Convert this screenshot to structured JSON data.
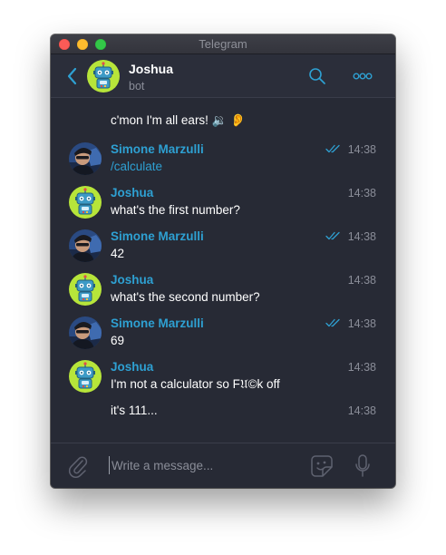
{
  "window": {
    "title": "Telegram"
  },
  "header": {
    "name": "Joshua",
    "status": "bot"
  },
  "messages": [
    {
      "kind": "continued",
      "sender": "",
      "text": "c'mon I'm all ears! 🔉 👂",
      "time": "",
      "outgoing": false,
      "avatar": ""
    },
    {
      "kind": "full",
      "sender": "Simone Marzulli",
      "text": "/calculate",
      "time": "14:38",
      "outgoing": true,
      "avatar": "user-photo",
      "link": true
    },
    {
      "kind": "full",
      "sender": "Joshua",
      "text": "what's the first number?",
      "time": "14:38",
      "outgoing": false,
      "avatar": "robot"
    },
    {
      "kind": "full",
      "sender": "Simone Marzulli",
      "text": "42",
      "time": "14:38",
      "outgoing": true,
      "avatar": "user-photo"
    },
    {
      "kind": "full",
      "sender": "Joshua",
      "text": "what's the second number?",
      "time": "14:38",
      "outgoing": false,
      "avatar": "robot"
    },
    {
      "kind": "full",
      "sender": "Simone Marzulli",
      "text": "69",
      "time": "14:38",
      "outgoing": true,
      "avatar": "user-photo"
    },
    {
      "kind": "full",
      "sender": "Joshua",
      "text": "I'm not a calculator so F𝔘©k off",
      "time": "14:38",
      "outgoing": false,
      "avatar": "robot"
    },
    {
      "kind": "continued",
      "sender": "",
      "text": "it's 111...",
      "time": "14:38",
      "outgoing": false,
      "avatar": ""
    }
  ],
  "composer": {
    "placeholder": "Write a message..."
  },
  "colors": {
    "accent": "#2ea0d2",
    "background": "#272a35",
    "header": "#2b2e3a",
    "muted": "#8a8d98"
  },
  "icons": {
    "back": "chevron-left-icon",
    "search": "search-icon",
    "more": "more-icon",
    "attach": "paperclip-icon",
    "sticker": "sticker-icon",
    "mic": "microphone-icon",
    "read": "double-check-icon"
  }
}
